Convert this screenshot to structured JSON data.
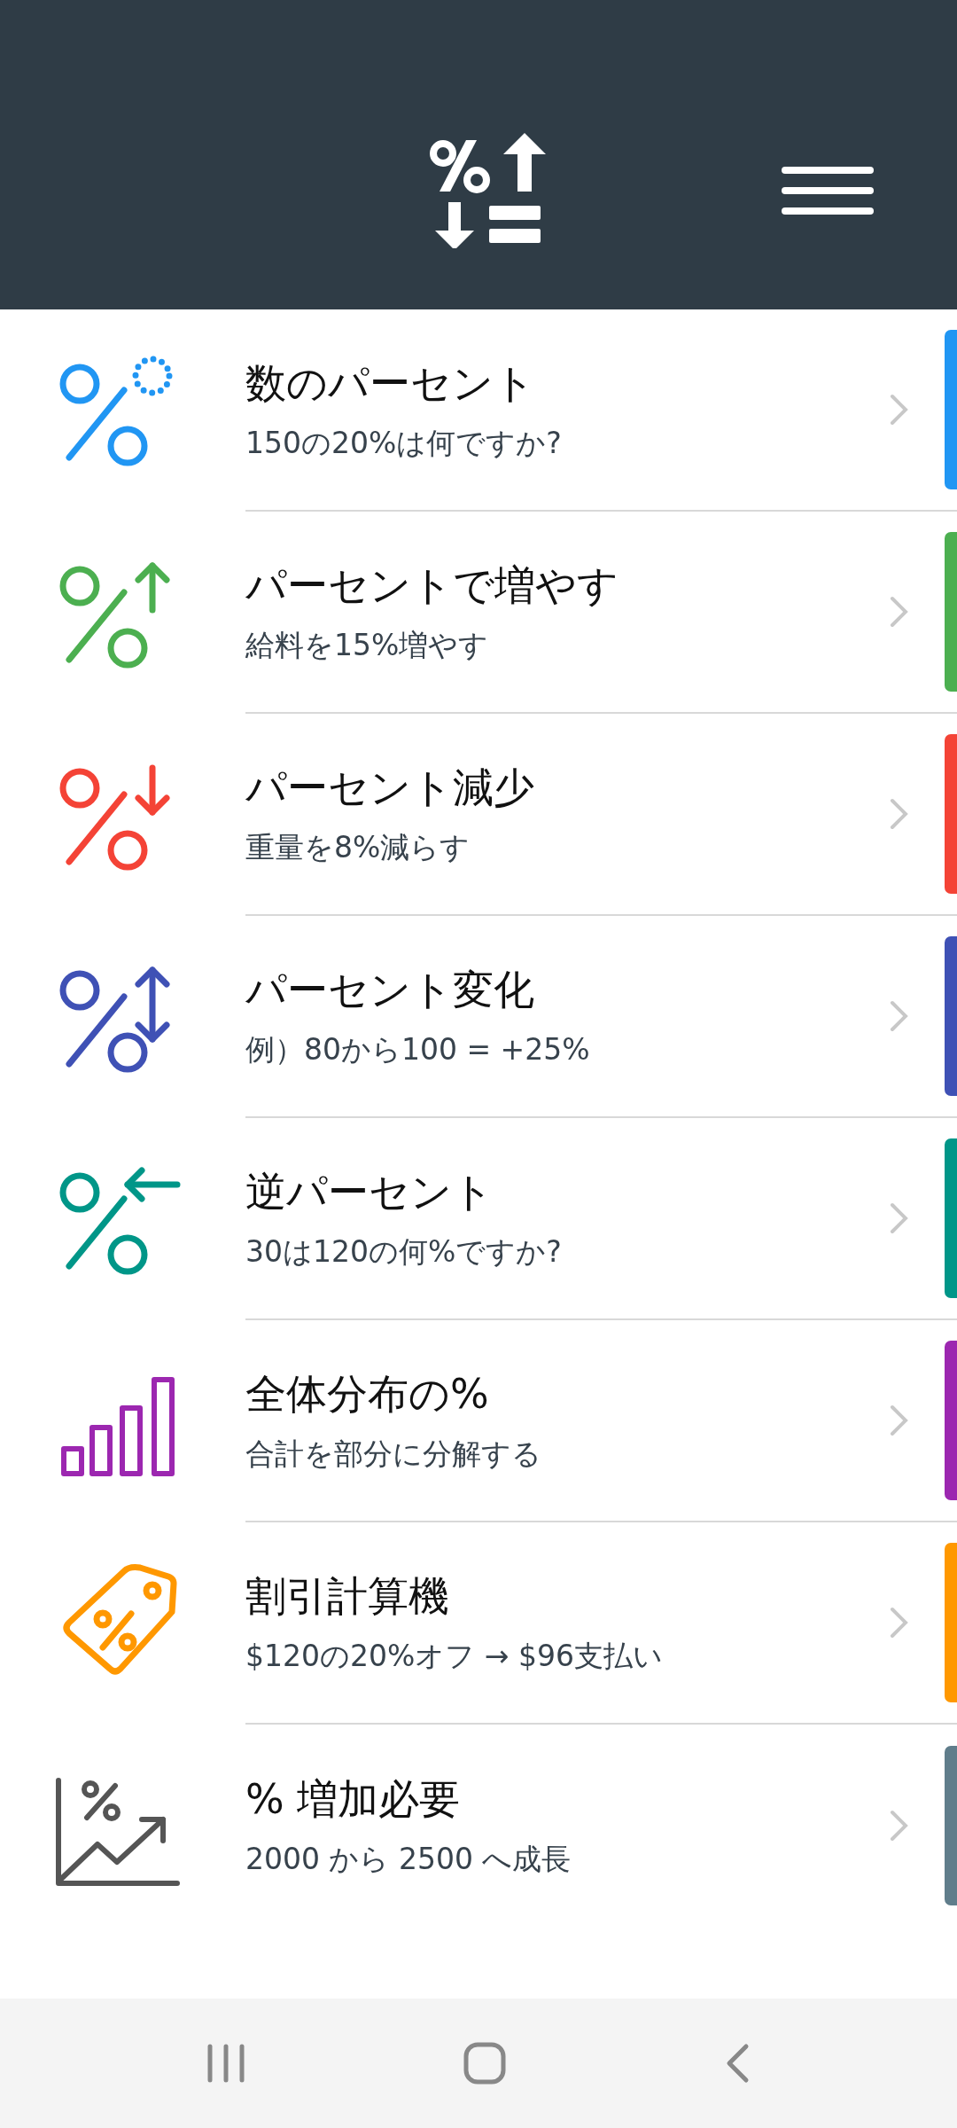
{
  "items": [
    {
      "title": "数のパーセント",
      "subtitle": "150の20%は何ですか?",
      "kind": "dots",
      "color": "#2196f3"
    },
    {
      "title": "パーセントで増やす",
      "subtitle": "給料を15%増やす",
      "kind": "up",
      "color": "#4caf50"
    },
    {
      "title": "パーセント減少",
      "subtitle": "重量を8%減らす",
      "kind": "down",
      "color": "#f44336"
    },
    {
      "title": "パーセント変化",
      "subtitle": "例）80から100 = +25%",
      "kind": "updown",
      "color": "#3f51b5"
    },
    {
      "title": "逆パーセント",
      "subtitle": "30は120の何%ですか?",
      "kind": "left",
      "color": "#009688"
    },
    {
      "title": "全体分布の%",
      "subtitle": "合計を部分に分解する",
      "kind": "bars",
      "color": "#9c27b0"
    },
    {
      "title": "割引計算機",
      "subtitle": "$120の20%オフ → $96支払い",
      "kind": "tag",
      "color": "#ff9800"
    },
    {
      "title": "% 増加必要",
      "subtitle": "2000 から 2500 へ成長",
      "kind": "chart",
      "color": "#607d8b"
    }
  ]
}
